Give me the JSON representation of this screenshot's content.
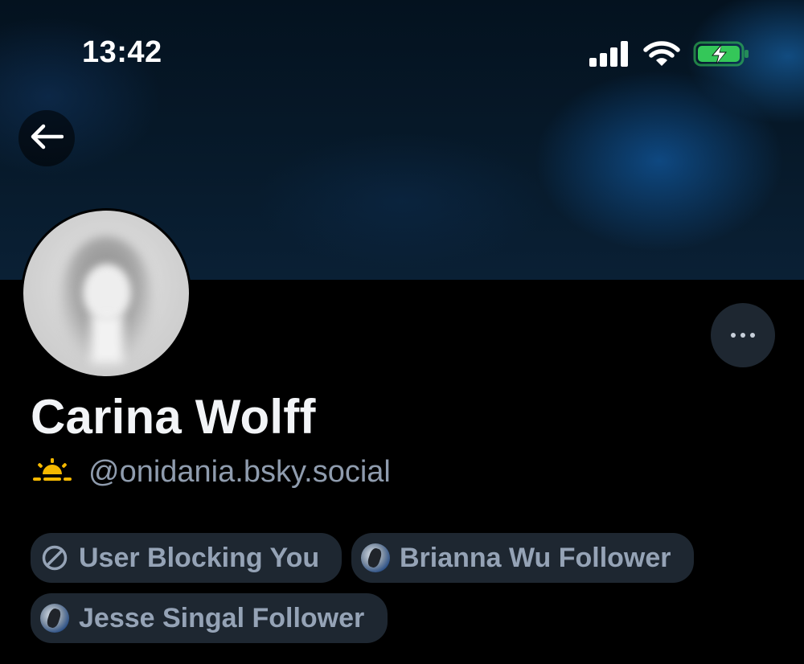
{
  "status_bar": {
    "time": "13:42",
    "signal_icon": "cellular-signal-icon",
    "wifi_icon": "wifi-icon",
    "battery_icon": "battery-charging-icon",
    "battery_color": "#34c759"
  },
  "header": {
    "back_icon": "arrow-left-icon"
  },
  "profile": {
    "display_name": "Carina Wolff",
    "handle_emoji": "sunrise-icon",
    "handle": "@onidania.bsky.social",
    "more_icon": "ellipsis-icon"
  },
  "badges": [
    {
      "label": "User Blocking You",
      "icon": "blocked-icon"
    },
    {
      "label": "Brianna Wu Follower",
      "icon": "avatar"
    },
    {
      "label": "Jesse Singal Follower",
      "icon": "avatar"
    }
  ],
  "colors": {
    "background": "#000000",
    "chip_background": "#1e2731",
    "chip_text": "#95a3b6",
    "handle_text": "#8f9cae",
    "emoji_yellow": "#f5b800"
  }
}
